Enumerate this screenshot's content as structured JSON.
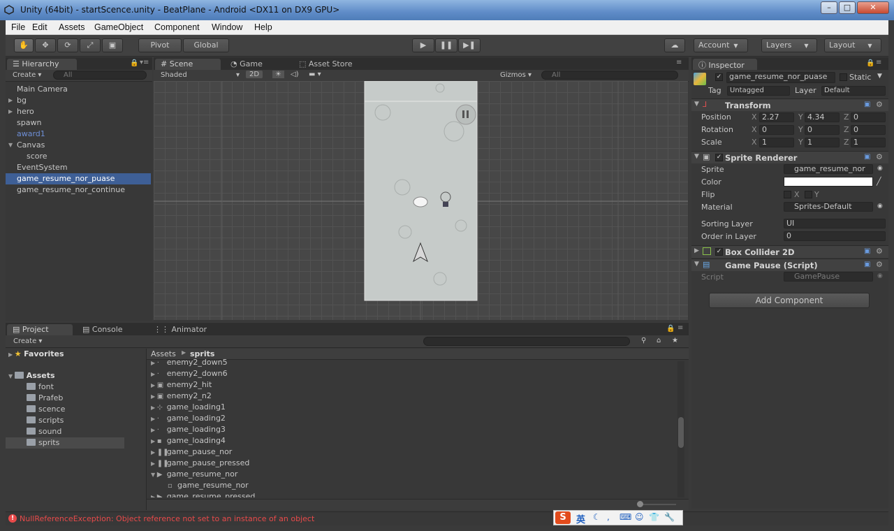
{
  "window": {
    "title": "Unity (64bit) - startScence.unity - BeatPlane - Android <DX11 on DX9 GPU>",
    "minimize": "–",
    "maximize": "□",
    "close": "✕"
  },
  "menu": [
    "File",
    "Edit",
    "Assets",
    "GameObject",
    "Component",
    "Window",
    "Help"
  ],
  "toolbar": {
    "pivot": "Pivot",
    "global": "Global",
    "play": "▶",
    "pause": "❚❚",
    "step": "▶❚",
    "account": "Account",
    "layers": "Layers",
    "layout": "Layout"
  },
  "hierarchy": {
    "tab": "Hierarchy",
    "create": "Create ▾",
    "search_placeholder": "All",
    "items": [
      {
        "label": "Main Camera",
        "indent": 0,
        "arrow": ""
      },
      {
        "label": "bg",
        "indent": 0,
        "arrow": "▶"
      },
      {
        "label": "hero",
        "indent": 0,
        "arrow": "▶"
      },
      {
        "label": "spawn",
        "indent": 0,
        "arrow": ""
      },
      {
        "label": "award1",
        "indent": 0,
        "arrow": ""
      },
      {
        "label": "Canvas",
        "indent": 0,
        "arrow": "▼"
      },
      {
        "label": "score",
        "indent": 1,
        "arrow": ""
      },
      {
        "label": "EventSystem",
        "indent": 0,
        "arrow": ""
      },
      {
        "label": "game_resume_nor_puase",
        "indent": 0,
        "arrow": ""
      },
      {
        "label": "game_resume_nor_continue",
        "indent": 0,
        "arrow": ""
      }
    ]
  },
  "scene": {
    "tabs": [
      "Scene",
      "Game",
      "Asset Store"
    ],
    "shaded": "Shaded",
    "mode2d": "2D",
    "gizmos": "Gizmos ▾",
    "search_placeholder": "All"
  },
  "inspector": {
    "tab": "Inspector",
    "object_name": "game_resume_nor_puase",
    "static": "Static",
    "tag_label": "Tag",
    "tag": "Untagged",
    "layer_label": "Layer",
    "layer": "Default",
    "transform": {
      "title": "Transform",
      "position_label": "Position",
      "position": {
        "x": "2.27",
        "y": "4.34",
        "z": "0"
      },
      "rotation_label": "Rotation",
      "rotation": {
        "x": "0",
        "y": "0",
        "z": "0"
      },
      "scale_label": "Scale",
      "scale": {
        "x": "1",
        "y": "1",
        "z": "1"
      }
    },
    "sprite_renderer": {
      "title": "Sprite Renderer",
      "sprite_label": "Sprite",
      "sprite": "game_resume_nor",
      "color_label": "Color",
      "flip_label": "Flip",
      "flip_x": "X",
      "flip_y": "Y",
      "material_label": "Material",
      "material": "Sprites-Default",
      "sorting_layer_label": "Sorting Layer",
      "sorting_layer": "UI",
      "order_label": "Order in Layer",
      "order": "0"
    },
    "box_collider": {
      "title": "Box Collider 2D"
    },
    "game_pause": {
      "title": "Game Pause (Script)",
      "script_label": "Script",
      "script": "GamePause"
    },
    "add_component": "Add Component"
  },
  "project": {
    "tabs": [
      "Project",
      "Console",
      "Animator"
    ],
    "create": "Create ▾",
    "favorites": "Favorites",
    "assets_root": "Assets",
    "folders": [
      "font",
      "Prafeb",
      "scence",
      "scripts",
      "sound",
      "sprits"
    ],
    "breadcrumb": [
      "Assets",
      "sprits"
    ],
    "files": [
      "enemy2_down5",
      "enemy2_down6",
      "enemy2_hit",
      "enemy2_n2",
      "game_loading1",
      "game_loading2",
      "game_loading3",
      "game_loading4",
      "game_pause_nor",
      "game_pause_pressed",
      "game_resume_nor",
      "game_resume_nor",
      "game_resume_pressed"
    ]
  },
  "status": {
    "error": "NullReferenceException: Object reference not set to an instance of an object"
  },
  "ime": {
    "lang": "英"
  },
  "colors": {
    "selection": "#3e5f96",
    "error": "#e84a4a",
    "link": "#6e8fd6"
  }
}
